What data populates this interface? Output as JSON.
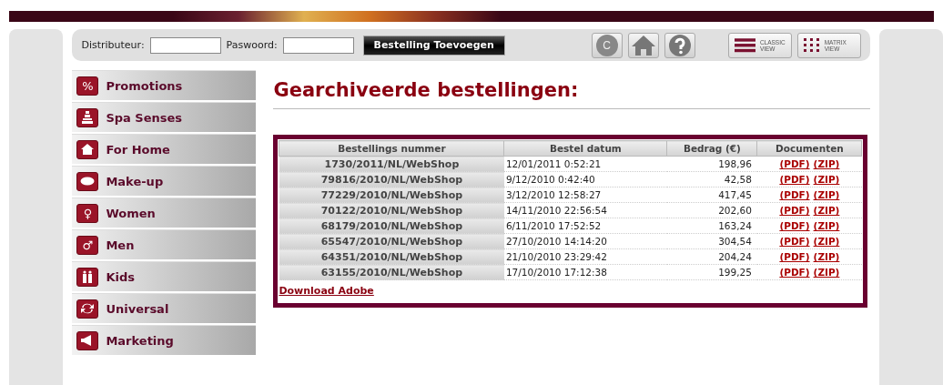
{
  "toolbar": {
    "distributor_label": "Distributeur:",
    "password_label": "Paswoord:",
    "add_button": "Bestelling Toevoegen",
    "view_buttons": [
      {
        "line1": "CLASSIC",
        "line2": "VIEW",
        "kind": "classic"
      },
      {
        "line1": "MATRIX",
        "line2": "VIEW",
        "kind": "matrix"
      }
    ],
    "circle_button": "C"
  },
  "sidebar": {
    "items": [
      {
        "label": "Promotions",
        "icon_text": "%"
      },
      {
        "label": "Spa Senses"
      },
      {
        "label": "For Home"
      },
      {
        "label": "Make-up"
      },
      {
        "label": "Women",
        "icon_text": "♀"
      },
      {
        "label": "Men",
        "icon_text": "♂"
      },
      {
        "label": "Kids"
      },
      {
        "label": "Universal"
      },
      {
        "label": "Marketing"
      }
    ]
  },
  "title": "Gearchiveerde bestellingen:",
  "table": {
    "columns": [
      "Bestellings nummer",
      "Bestel datum",
      "Bedrag (€)",
      "Documenten"
    ],
    "rows": [
      {
        "number": "1730/2011/NL/WebShop",
        "date": "12/01/2011 0:52:21",
        "amount": "198,96",
        "links": [
          "(PDF)",
          "(ZIP)"
        ]
      },
      {
        "number": "79816/2010/NL/WebShop",
        "date": "9/12/2010 0:42:40",
        "amount": "42,58",
        "links": [
          "(PDF)",
          "(ZIP)"
        ]
      },
      {
        "number": "77229/2010/NL/WebShop",
        "date": "3/12/2010 12:58:27",
        "amount": "417,45",
        "links": [
          "(PDF)",
          "(ZIP)"
        ]
      },
      {
        "number": "70122/2010/NL/WebShop",
        "date": "14/11/2010 22:56:54",
        "amount": "202,60",
        "links": [
          "(PDF)",
          "(ZIP)"
        ]
      },
      {
        "number": "68179/2010/NL/WebShop",
        "date": "6/11/2010 17:52:52",
        "amount": "163,24",
        "links": [
          "(PDF)",
          "(ZIP)"
        ]
      },
      {
        "number": "65547/2010/NL/WebShop",
        "date": "27/10/2010 14:14:20",
        "amount": "304,54",
        "links": [
          "(PDF)",
          "(ZIP)"
        ]
      },
      {
        "number": "64351/2010/NL/WebShop",
        "date": "21/10/2010 23:29:42",
        "amount": "204,24",
        "links": [
          "(PDF)",
          "(ZIP)"
        ]
      },
      {
        "number": "63155/2010/NL/WebShop",
        "date": "17/10/2010 17:12:38",
        "amount": "199,25",
        "links": [
          "(PDF)",
          "(ZIP)"
        ]
      }
    ],
    "footer_link": "Download Adobe"
  }
}
